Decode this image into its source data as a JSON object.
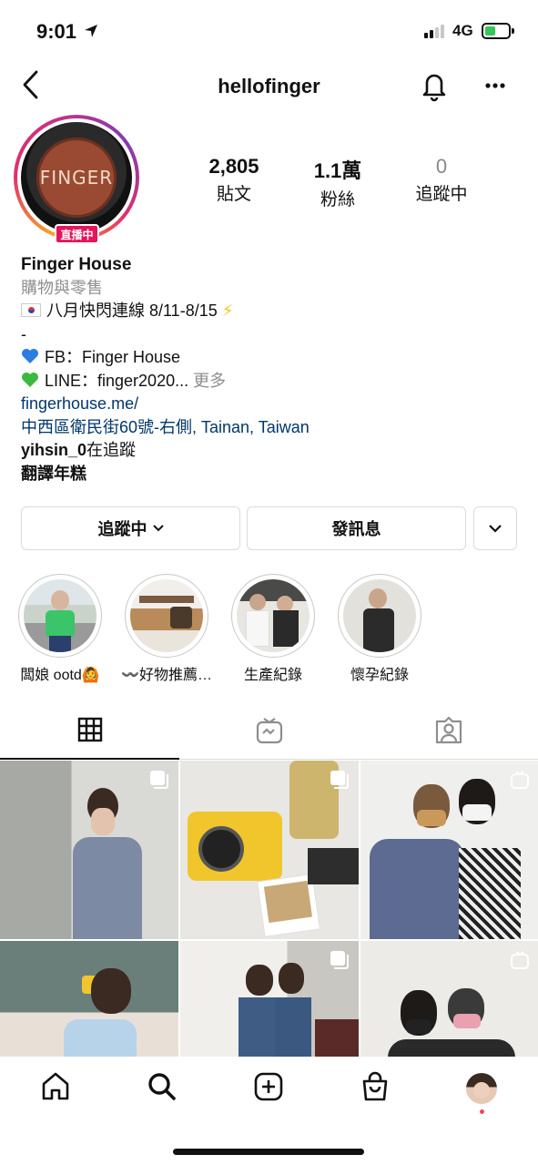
{
  "status_bar": {
    "time": "9:01",
    "network": "4G"
  },
  "header": {
    "username": "hellofinger"
  },
  "profile": {
    "avatar_text": "FINGER",
    "live_badge": "直播中",
    "stats": [
      {
        "value": "2,805",
        "label": "貼文"
      },
      {
        "value": "1.1萬",
        "label": "粉絲"
      },
      {
        "value": "0",
        "label": "追蹤中"
      }
    ]
  },
  "bio": {
    "name": "Finger House",
    "category": "購物與零售",
    "line1": "八月快閃連線 8/11-8/15",
    "line1_emoji": "⚡",
    "dash": "-",
    "fb": "FB：Finger House",
    "line": "LINE：finger2020...",
    "more": "更多",
    "link": "fingerhouse.me/",
    "address": "中西區衛民街60號-右側, Tainan, Taiwan",
    "followed_by_user": "yihsin_0",
    "followed_by_suffix": "在追蹤",
    "translate": "翻譯年糕"
  },
  "actions": {
    "following": "追蹤中",
    "message": "發訊息"
  },
  "highlights": [
    {
      "label": "闆娘 ootd🙆"
    },
    {
      "label": "〰️好物推薦…"
    },
    {
      "label": "生產紀錄"
    },
    {
      "label": "懷孕紀錄"
    }
  ],
  "colors": {
    "link": "#00376b",
    "live": "#e6135d",
    "secondary_text": "#8e8e8e",
    "border": "#dbdbdb"
  }
}
